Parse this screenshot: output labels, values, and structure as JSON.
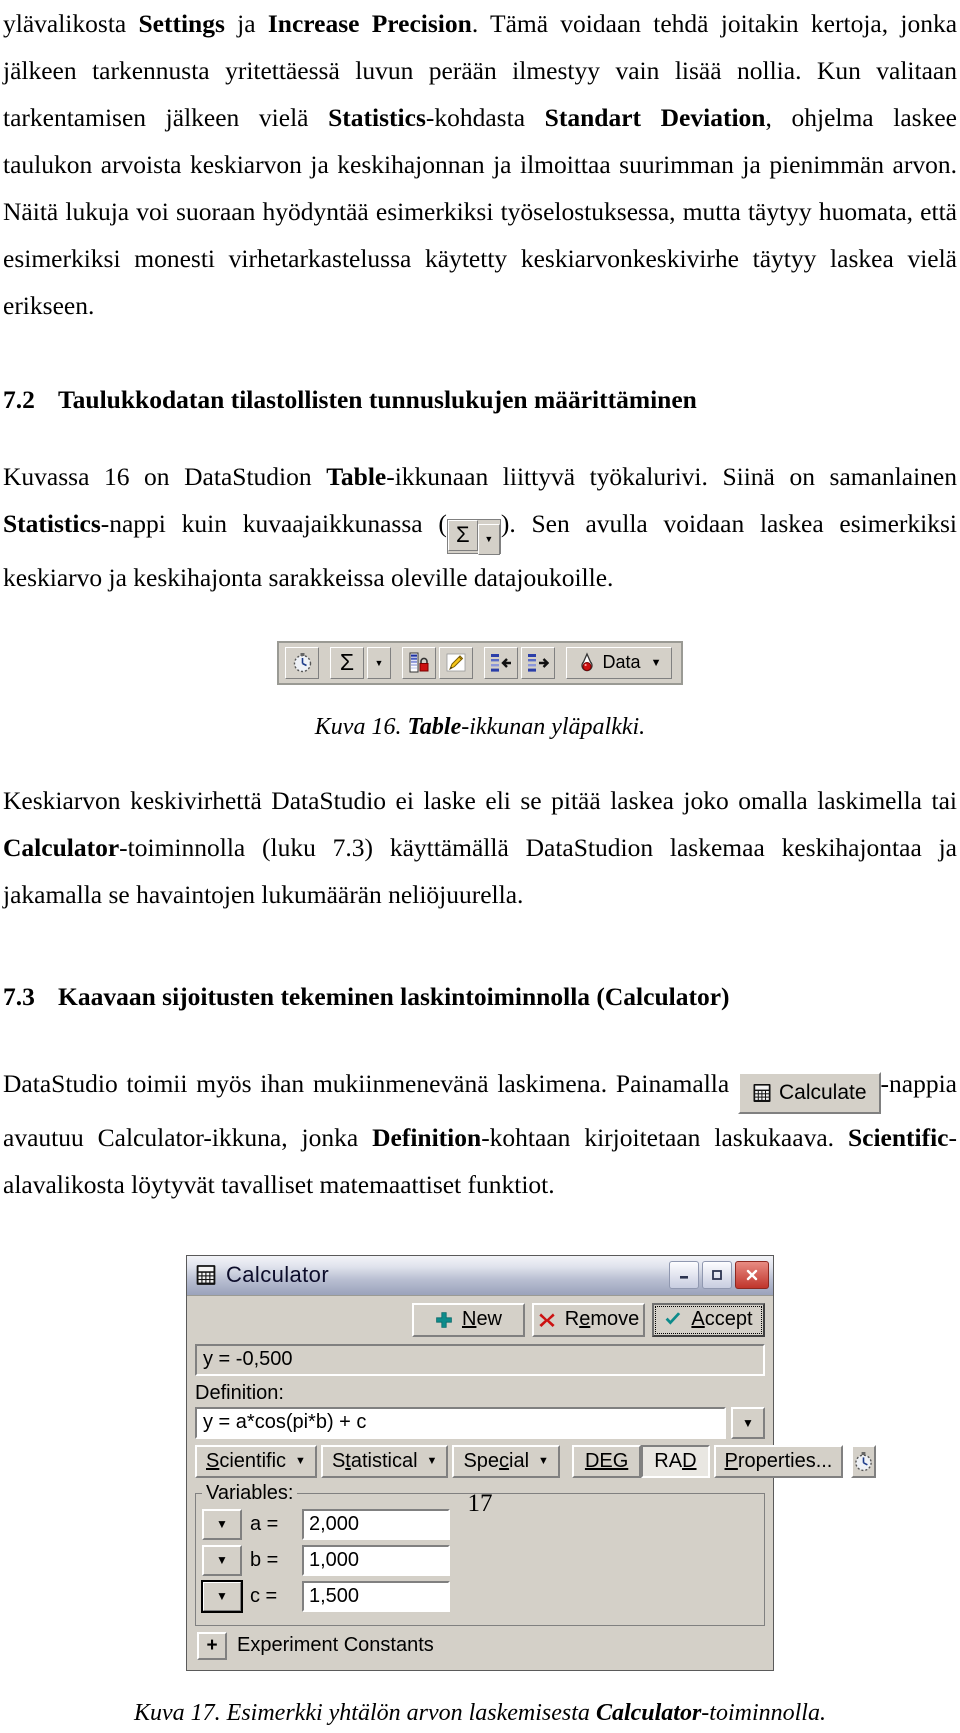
{
  "document": {
    "page_number": "17",
    "paragraph_1": {
      "segments": [
        {
          "t": "ylävalikosta ",
          "b": false
        },
        {
          "t": "Settings",
          "b": true
        },
        {
          "t": " ja ",
          "b": false
        },
        {
          "t": "Increase Precision",
          "b": true
        },
        {
          "t": ". Tämä voidaan tehdä joitakin kertoja, jonka jälkeen tarkennusta yritettäessä luvun perään ilmestyy vain lisää nollia. Kun valitaan tarkentamisen jälkeen vielä ",
          "b": false
        },
        {
          "t": "Statistics",
          "b": true
        },
        {
          "t": "-kohdasta ",
          "b": false
        },
        {
          "t": "Standart Deviation",
          "b": true
        },
        {
          "t": ", ohjelma laskee taulukon arvoista keskiarvon ja keskihajonnan ja ilmoittaa suurimman ja pienimmän arvon. Näitä lukuja voi suoraan hyödyntää esimerkiksi työselostuksessa, mutta täytyy huomata, että esimerkiksi monesti virhetarkastelussa käytetty keskiarvonkeskivirhe täytyy laskea vielä erikseen.",
          "b": false
        }
      ]
    },
    "section_7_2": {
      "number": "7.2",
      "title": "Taulukkodatan tilastollisten tunnuslukujen määrittäminen"
    },
    "paragraph_2a": {
      "segments": [
        {
          "t": "Kuvassa 16 on DataStudion ",
          "b": false
        },
        {
          "t": "Table",
          "b": true
        },
        {
          "t": "-ikkunaan liittyvä työkalurivi. Siinä on samanlainen ",
          "b": false
        },
        {
          "t": "Statistics",
          "b": true
        },
        {
          "t": "-nappi kuin kuvaajaikkunassa (",
          "b": false
        }
      ]
    },
    "paragraph_2b": {
      "segments": [
        {
          "t": "). Sen avulla voidaan laskea esimerkiksi keskiarvo ja keskihajonta sarakkeissa oleville datajoukoille.",
          "b": false
        }
      ]
    },
    "figure_16": {
      "toolbar": {
        "buttons": [
          {
            "name": "stopwatch",
            "label": ""
          },
          {
            "name": "sigma",
            "label": "Σ"
          },
          {
            "name": "sigma-dropdown",
            "label": "▼"
          },
          {
            "name": "lock-data",
            "label": ""
          },
          {
            "name": "edit-pencil",
            "label": ""
          },
          {
            "name": "insert-left",
            "label": ""
          },
          {
            "name": "insert-right",
            "label": ""
          },
          {
            "name": "data",
            "label": "Data"
          },
          {
            "name": "data-dropdown",
            "label": "▼"
          }
        ]
      },
      "caption": {
        "segments": [
          {
            "t": "Kuva 16. ",
            "b": false
          },
          {
            "t": "Table",
            "b": true
          },
          {
            "t": "-ikkunan yläpalkki.",
            "b": false
          }
        ]
      }
    },
    "paragraph_3": {
      "segments": [
        {
          "t": "Keskiarvon keskivirhettä DataStudio ei laske eli se pitää laskea joko omalla laskimella tai ",
          "b": false
        },
        {
          "t": "Calculator",
          "b": true
        },
        {
          "t": "-toiminnolla (luku 7.3) käyttämällä DataStudion laskemaa keskihajontaa ja jakamalla se havaintojen lukumäärän neliöjuurella.",
          "b": false
        }
      ]
    },
    "section_7_3": {
      "number": "7.3",
      "title": "Kaavaan sijoitusten tekeminen laskintoiminnolla (Calculator)"
    },
    "paragraph_4a": {
      "segments": [
        {
          "t": "DataStudio toimii myös ihan mukiinmenevänä laskimena. Painamalla ",
          "b": false
        }
      ]
    },
    "calculate_button": {
      "label": "Calculate",
      "icon": "calculator-icon"
    },
    "paragraph_4b": {
      "segments": [
        {
          "t": "-nappia avautuu Calculator-ikkuna, jonka ",
          "b": false
        },
        {
          "t": "Definition",
          "b": true
        },
        {
          "t": "-kohtaan kirjoitetaan laskukaava. ",
          "b": false
        },
        {
          "t": "Scientific",
          "b": true
        },
        {
          "t": "-alavalikosta löytyvät tavalliset matemaattiset funktiot.",
          "b": false
        }
      ]
    },
    "figure_17": {
      "window": {
        "title": "Calculator",
        "icon": "calculator-icon",
        "system_buttons": {
          "minimize": "minimize-icon",
          "maximize": "maximize-icon",
          "close": "close-icon"
        },
        "actions": [
          {
            "name": "new",
            "label": "New",
            "mnemonic": "N",
            "icon": "plus-icon",
            "icon_color": "#0d8b8b"
          },
          {
            "name": "remove",
            "label": "Remove",
            "mnemonic": "e",
            "icon": "x-icon",
            "icon_color": "#cc1111"
          },
          {
            "name": "accept",
            "label": "Accept",
            "mnemonic": "A",
            "icon": "check-icon",
            "icon_color": "#0d8b8b"
          }
        ],
        "result_value": "y = -0,500",
        "definition_label": "Definition:",
        "definition_value": "y = a*cos(pi*b) + c",
        "definition_dropdown": "▼",
        "menu_buttons": [
          {
            "name": "scientific",
            "label": "Scientific",
            "mnemonic": "S",
            "caret": "▼"
          },
          {
            "name": "statistical",
            "label": "Statistical",
            "mnemonic": "t",
            "caret": "▼"
          },
          {
            "name": "special",
            "label": "Special",
            "mnemonic": "c",
            "caret": "▼"
          }
        ],
        "angle_modes": [
          {
            "name": "deg",
            "label": "DEG",
            "active": false
          },
          {
            "name": "rad",
            "label": "RAD",
            "active": true
          }
        ],
        "properties_button": {
          "label": "Properties...",
          "mnemonic": "P"
        },
        "stopwatch_button": {
          "name": "stopwatch-icon"
        },
        "variables_legend": "Variables:",
        "variables": [
          {
            "name": "a",
            "label": "a =",
            "value": "2,000",
            "dropdown": "▼",
            "focused": false
          },
          {
            "name": "b",
            "label": "b =",
            "value": "1,000",
            "dropdown": "▼",
            "focused": false
          },
          {
            "name": "c",
            "label": "c =",
            "value": "1,500",
            "dropdown": "▼",
            "focused": true
          }
        ],
        "experiment_constants": {
          "expand": "+",
          "label": "Experiment Constants"
        }
      },
      "caption": {
        "segments": [
          {
            "t": "Kuva 17. Esimerkki yhtälön arvon laskemisesta ",
            "b": false
          },
          {
            "t": "Calculator",
            "b": true
          },
          {
            "t": "-toiminnolla.",
            "b": false
          }
        ]
      }
    }
  }
}
